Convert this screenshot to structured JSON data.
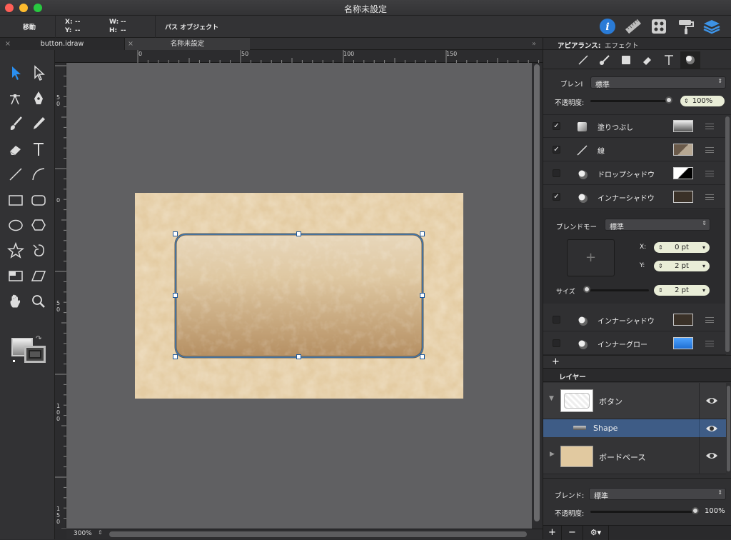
{
  "window": {
    "title": "名称未設定",
    "traffic_colors": [
      "#ff5f57",
      "#febc2e",
      "#28c840"
    ]
  },
  "infobar": {
    "move_label": "移動",
    "x_label": "X:",
    "x_value": "--",
    "y_label": "Y:",
    "y_value": "--",
    "w_label": "W:",
    "w_value": "--",
    "h_label": "H:",
    "h_value": "--",
    "object_type": "パス オブジェクト"
  },
  "top_icons": [
    "info-icon",
    "ruler-icon",
    "grid-icon",
    "paint-roller-icon",
    "layers-icon"
  ],
  "tabs": {
    "close_glyph": "×",
    "overflow_glyph": "»",
    "items": [
      {
        "label": "button.idraw"
      },
      {
        "label": "名称未設定"
      }
    ]
  },
  "tools": [
    "pointer-tool-icon",
    "direct-select-tool-icon",
    "node-tool-icon",
    "pen-tool-icon",
    "brush-tool-icon",
    "pencil-tool-icon",
    "eraser-tool-icon",
    "text-tool-icon",
    "line-tool-icon",
    "arc-tool-icon",
    "rectangle-tool-icon",
    "rounded-rectangle-tool-icon",
    "ellipse-tool-icon",
    "hexagon-tool-icon",
    "star-tool-icon",
    "spiral-tool-icon",
    "frame-tool-icon",
    "parallelogram-tool-icon",
    "hand-tool-icon",
    "zoom-tool-icon"
  ],
  "ruler": {
    "h_labels": [
      "0",
      "50",
      "100",
      "150"
    ],
    "v_labels": [
      "50",
      "0",
      "50",
      "100",
      "150"
    ]
  },
  "status": {
    "zoom": "300%"
  },
  "panel": {
    "header_tab1": "アピアランス:",
    "header_tab2": "エフェクト",
    "style_icons": [
      "line-style-icon",
      "brush-style-icon",
      "fill-style-icon",
      "eraser-style-icon",
      "text-style-icon",
      "effect-style-icon"
    ],
    "blend_label": "ブレンI",
    "blend_value": "標準",
    "opacity_label": "不透明度:",
    "opacity_value": "100%",
    "opacity_level": 1.0,
    "effects": [
      {
        "checked": true,
        "icon": "fill-gradient-icon",
        "name": "塗りつぶし",
        "swatch": "gradient-gray"
      },
      {
        "checked": true,
        "icon": "stroke-line-icon",
        "name": "線",
        "swatch": "brown-diagonal"
      },
      {
        "checked": false,
        "icon": "shadow-ball-icon",
        "name": "ドロップシャドウ",
        "swatch": "black-white"
      },
      {
        "checked": true,
        "icon": "shadow-ball-icon",
        "name": "インナーシャドウ",
        "swatch": "dark-brown"
      }
    ],
    "inner_shadow_detail": {
      "blend_label": "ブレンドモー",
      "blend_value": "標準",
      "crosshair": "+",
      "x_label": "X:",
      "x_value": "0 pt",
      "y_label": "Y:",
      "y_value": "2 pt",
      "size_label": "サイズ",
      "size_value": "2 pt"
    },
    "effects2": [
      {
        "checked": false,
        "icon": "shadow-ball-icon",
        "name": "インナーシャドウ",
        "swatch": "dark-brown"
      },
      {
        "checked": false,
        "icon": "shadow-ball-icon",
        "name": "インナーグロー",
        "swatch": "blue"
      }
    ],
    "add_glyph": "+",
    "layers_title": "レイヤー",
    "layers": [
      {
        "name": "ボタン",
        "expanded": true
      },
      {
        "name": "Shape",
        "selected": true
      },
      {
        "name": "ボードベース",
        "expanded": false
      }
    ],
    "bottom_blend_label": "ブレンド:",
    "bottom_blend_value": "標準",
    "bottom_opacity_label": "不透明度:",
    "bottom_opacity_value": "100%",
    "bottom_opacity_level": 1.0,
    "footer_buttons": [
      "+",
      "−",
      "⚙▾"
    ]
  },
  "colors": {
    "accent_blue": "#2a7bd6",
    "selection_row": "#3e5c86",
    "canvas_bg": "#606062",
    "parchment": "#e6cfa8"
  }
}
